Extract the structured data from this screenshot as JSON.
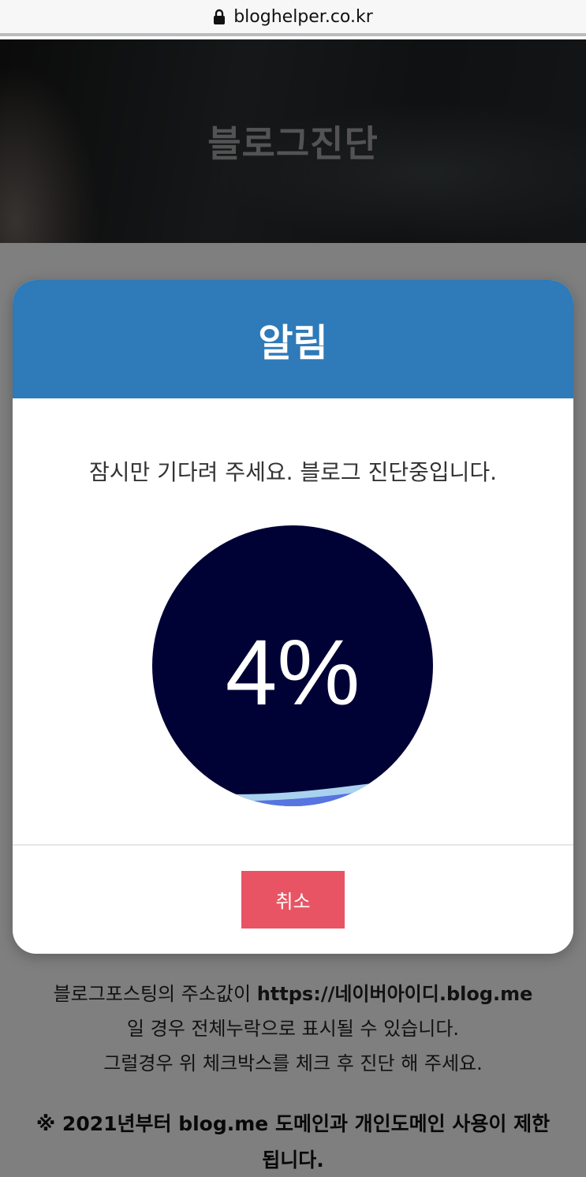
{
  "browser": {
    "url": "bloghelper.co.kr"
  },
  "hero": {
    "title": "블로그진단"
  },
  "page": {
    "info_line1_prefix": "블로그포스팅의 주소값이 ",
    "info_line1_url": "https://네이버아이디.blog.me",
    "info_line2": "일 경우 전체누락으로 표시될 수 있습니다.",
    "info_line3": "그럴경우 위 체크박스를 체크 후 진단 해 주세요.",
    "notice_line1": "※ 2021년부터 blog.me 도메인과 개인도메인 사용이 제한",
    "notice_line2": "됩니다."
  },
  "modal": {
    "title": "알림",
    "message": "잠시만 기다려 주세요. 블로그 진단중입니다.",
    "progress_text": "4%",
    "progress_value": 4,
    "cancel_label": "취소"
  },
  "colors": {
    "header": "#2f7ab8",
    "progress_bg": "#000235",
    "progress_wave": "#5774e0",
    "progress_wave_light": "#a9d2ef",
    "cancel": "#e85463"
  }
}
